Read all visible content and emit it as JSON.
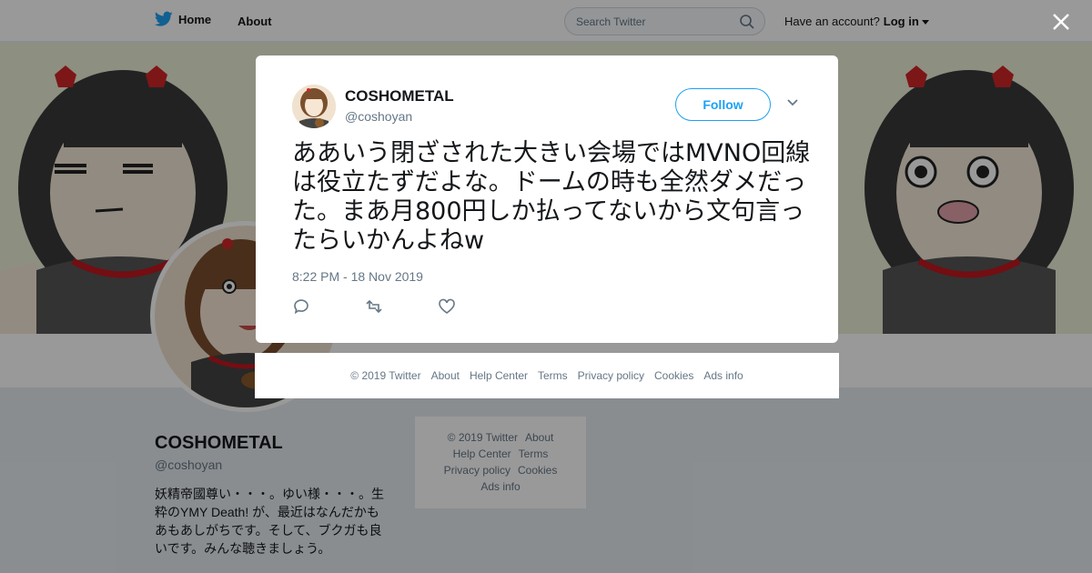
{
  "nav": {
    "home_label": "Home",
    "about_label": "About",
    "search_placeholder": "Search Twitter",
    "have_account_text": "Have an account?",
    "login_label": "Log in"
  },
  "profile": {
    "name": "COSHOMETAL",
    "handle": "@coshoyan",
    "bio": "妖精帝國尊い・・・。ゆい様・・・。生粋のYMY Death! が、最近はなんだかもあもあしがちです。そして、ブクガも良いです。みんな聴きましょう。"
  },
  "side_footer": {
    "line1": [
      "© 2019 Twitter",
      "About"
    ],
    "line2": [
      "Help Center",
      "Terms"
    ],
    "line3": [
      "Privacy policy",
      "Cookies"
    ],
    "line4": [
      "Ads info"
    ]
  },
  "tweet": {
    "name": "COSHOMETAL",
    "handle": "@coshoyan",
    "follow_label": "Follow",
    "text": "ああいう閉ざされた大きい会場ではMVNO回線は役立たずだよな。ドームの時も全然ダメだった。まあ月800円しか払ってないから文句言ったらいかんよねw",
    "timestamp": "8:22 PM - 18 Nov 2019"
  },
  "modal_footer": {
    "links": [
      "© 2019 Twitter",
      "About",
      "Help Center",
      "Terms",
      "Privacy policy",
      "Cookies",
      "Ads info"
    ]
  },
  "colors": {
    "brand": "#1da1f2",
    "text": "#14171a",
    "secondary": "#657786"
  },
  "icons": [
    "twitter-bird-icon",
    "search-icon",
    "close-icon",
    "chevron-down-icon",
    "reply-icon",
    "retweet-icon",
    "like-icon"
  ]
}
